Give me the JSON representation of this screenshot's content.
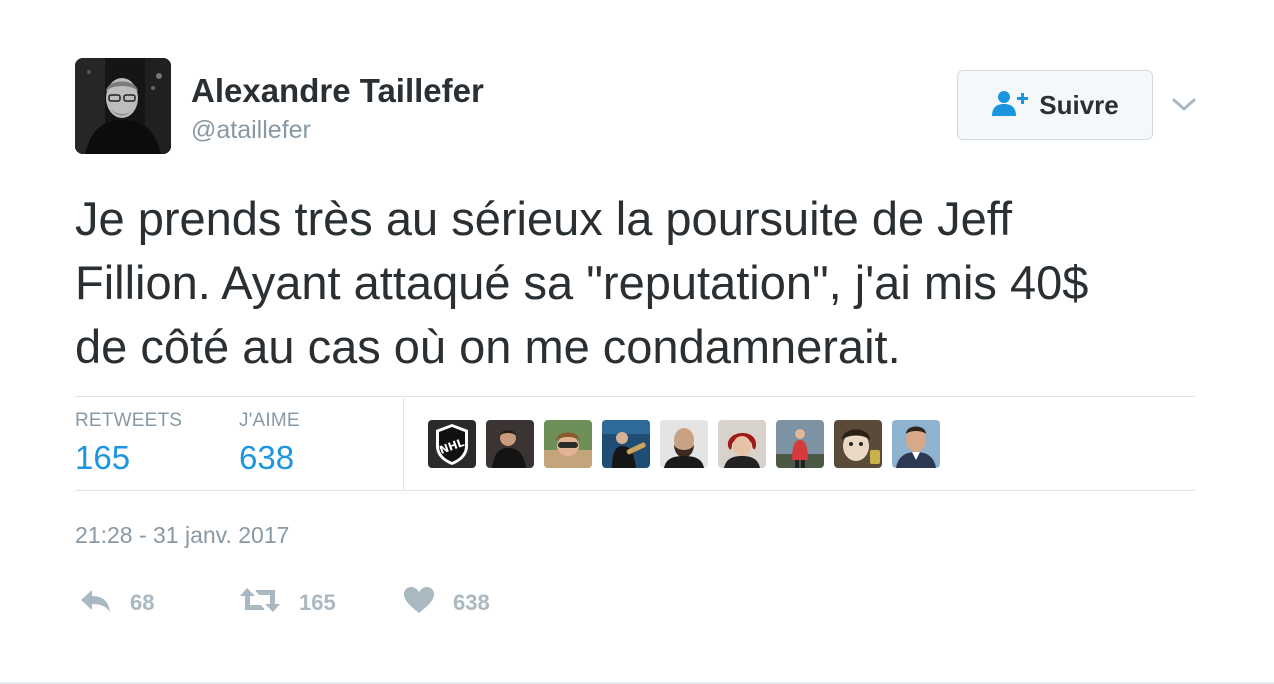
{
  "author": {
    "name": "Alexandre Taillefer",
    "handle": "@ataillefer"
  },
  "follow_button": {
    "label": "Suivre"
  },
  "tweet": {
    "text": "Je prends très au sérieux la poursuite de Jeff\nFillion. Ayant attaqué sa \"reputation\", j'ai mis 40$\nde côté au cas où on me condamnerait.",
    "timestamp": "21:28 - 31 janv. 2017"
  },
  "stats": {
    "retweets_label": "RETWEETS",
    "retweets_value": "165",
    "likes_label": "J'AIME",
    "likes_value": "638"
  },
  "likers": [
    {
      "name": "nhl-logo-avatar"
    },
    {
      "name": "liker-avatar-2"
    },
    {
      "name": "liker-avatar-3"
    },
    {
      "name": "liker-avatar-4"
    },
    {
      "name": "liker-avatar-5"
    },
    {
      "name": "liker-avatar-6"
    },
    {
      "name": "liker-avatar-7"
    },
    {
      "name": "liker-avatar-8"
    },
    {
      "name": "liker-avatar-9"
    }
  ],
  "actions": {
    "reply_count": "68",
    "retweet_count": "165",
    "like_count": "638"
  },
  "colors": {
    "text": "#292f33",
    "muted": "#8899a6",
    "accent": "#1b95e0",
    "icon": "#aab8c2"
  },
  "icons": {
    "follow": "add-user-icon",
    "menu": "chevron-down-icon",
    "reply": "reply-icon",
    "retweet": "retweet-icon",
    "like": "heart-icon"
  }
}
